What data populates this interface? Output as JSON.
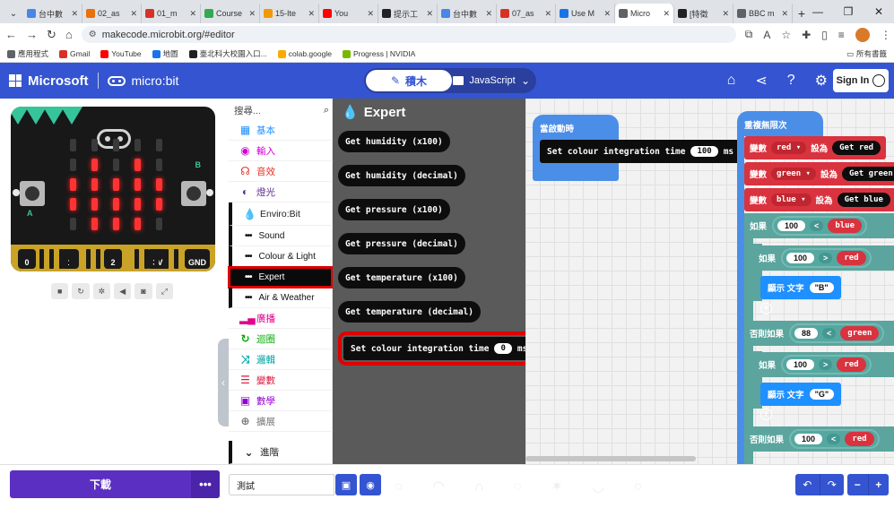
{
  "browser": {
    "tabs": [
      {
        "label": "台中數",
        "color": "#4a86e8"
      },
      {
        "label": "02_as",
        "color": "#e8710a"
      },
      {
        "label": "01_m",
        "color": "#d93025"
      },
      {
        "label": "Course",
        "color": "#34a853"
      },
      {
        "label": "15-Ite",
        "color": "#f29900"
      },
      {
        "label": "You",
        "color": "#ff0000"
      },
      {
        "label": "提示工",
        "color": "#202124"
      },
      {
        "label": "台中數",
        "color": "#4a86e8"
      },
      {
        "label": "07_as",
        "color": "#d93025"
      },
      {
        "label": "Use M",
        "color": "#1a73e8"
      },
      {
        "label": "Micro",
        "color": "#5f6368"
      },
      {
        "label": "[特徵",
        "color": "#202124"
      },
      {
        "label": "BBC m",
        "color": "#5f6368"
      }
    ],
    "url": "makecode.microbit.org/#editor",
    "bookmarks": [
      "應用程式",
      "Gmail",
      "YouTube",
      "地圖",
      "臺北科大校園入口...",
      "colab.google",
      "Progress | NVIDIA"
    ],
    "bookmarks_right": "所有書籤"
  },
  "header": {
    "brand_ms": "Microsoft",
    "brand_mb": "micro:bit",
    "blocks_label": "積木",
    "js_label": "JavaScript",
    "signin_label": "Sign In",
    "accent": "#3454d1"
  },
  "simulator": {
    "pins": [
      "0",
      "1",
      "2",
      "3V",
      "GND"
    ],
    "button_a": "A",
    "button_b": "B",
    "leds": [
      [
        0,
        0,
        0,
        0,
        0
      ],
      [
        0,
        1,
        0,
        1,
        0
      ],
      [
        1,
        1,
        1,
        1,
        1
      ],
      [
        1,
        1,
        1,
        1,
        1
      ],
      [
        0,
        1,
        1,
        1,
        0
      ]
    ]
  },
  "toolbox": {
    "search_placeholder": "搜尋...",
    "categories": [
      {
        "label": "基本",
        "icon": "grid-icon",
        "color": "#1e90ff"
      },
      {
        "label": "輸入",
        "icon": "target-icon",
        "color": "#d400d4"
      },
      {
        "label": "音效",
        "icon": "headphones-icon",
        "color": "#e63022"
      },
      {
        "label": "燈光",
        "icon": "toggle-icon",
        "color": "#5c2d91"
      },
      {
        "label": "Enviro:Bit",
        "icon": "droplet-icon",
        "color": "#111111"
      }
    ],
    "subcategories": [
      {
        "label": "Sound"
      },
      {
        "label": "Colour & Light"
      },
      {
        "label": "Expert"
      },
      {
        "label": "Air & Weather"
      }
    ],
    "categories2": [
      {
        "label": "廣播",
        "icon": "signal-icon",
        "color": "#e3008c"
      },
      {
        "label": "迴圈",
        "icon": "loop-icon",
        "color": "#00aa00"
      },
      {
        "label": "邏輯",
        "icon": "shuffle-icon",
        "color": "#00a4a6"
      },
      {
        "label": "變數",
        "icon": "list-icon",
        "color": "#dc143c"
      },
      {
        "label": "數學",
        "icon": "calculator-icon",
        "color": "#9400d3"
      },
      {
        "label": "擴展",
        "icon": "plus-circle-icon",
        "color": "#777777"
      },
      {
        "label": "進階",
        "icon": "chevron-down-icon",
        "color": "#222222"
      }
    ]
  },
  "flyout": {
    "title": "Expert",
    "blocks": [
      "Get humidity (x100)",
      "Get humidity (decimal)",
      "Get pressure (x100)",
      "Get pressure (decimal)",
      "Get temperature (x100)",
      "Get temperature (decimal)"
    ],
    "stmt_label": "Set colour integration time",
    "stmt_value": "0",
    "stmt_unit": "ms"
  },
  "workspace": {
    "on_start": "當啟動時",
    "on_start_stmt": "Set colour integration time",
    "on_start_value": "100",
    "on_start_unit": "ms",
    "forever": "重複無限次",
    "var_label": "變數",
    "set_label": "設為",
    "vars": [
      {
        "name": "red",
        "getter": "Get red"
      },
      {
        "name": "green",
        "getter": "Get green"
      },
      {
        "name": "blue",
        "getter": "Get blue"
      }
    ],
    "if_label": "如果",
    "elseif_label": "否則如果",
    "show_label": "顯示 文字",
    "lt": "<",
    "gt": ">",
    "if1": {
      "left": "100",
      "right": "blue"
    },
    "if1_inner": {
      "left": "100",
      "right": "red",
      "text": "\"B\""
    },
    "elseif1": {
      "left": "88",
      "right": "green"
    },
    "elseif1_inner": {
      "left": "100",
      "right": "red",
      "text": "\"G\""
    },
    "elseif2": {
      "left": "100",
      "right": "red"
    }
  },
  "bottom": {
    "download_label": "下載",
    "more_label": "•••",
    "project_name": "測試"
  }
}
